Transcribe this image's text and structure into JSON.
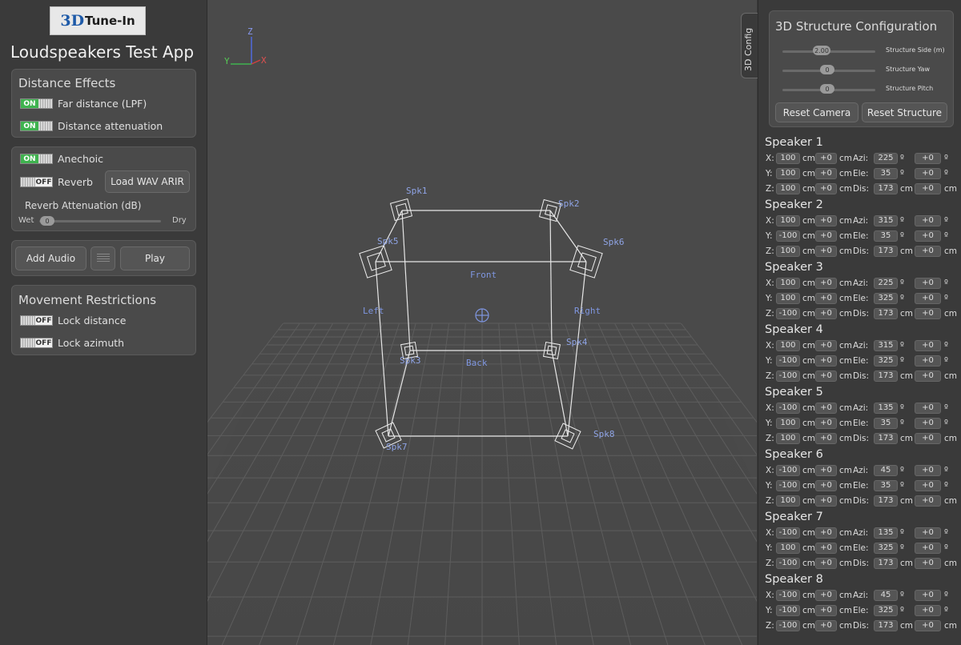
{
  "logo": {
    "mark": "3D",
    "text": "Tune-In"
  },
  "app_title": "Loudspeakers Test App",
  "distance_effects": {
    "title": "Distance Effects",
    "far_distance": {
      "state": "ON",
      "label": "Far distance (LPF)"
    },
    "attenuation": {
      "state": "ON",
      "label": "Distance attenuation"
    }
  },
  "environment": {
    "anechoic": {
      "state": "ON",
      "label": "Anechoic"
    },
    "reverb": {
      "state": "OFF",
      "label": "Reverb"
    },
    "load_button": "Load WAV ARIR",
    "reverb_attenuation_label": "Reverb Attenuation (dB)",
    "wet_label": "Wet",
    "dry_label": "Dry",
    "slider_value": "0"
  },
  "audio": {
    "add_label": "Add Audio",
    "play_label": "Play"
  },
  "movement": {
    "title": "Movement Restrictions",
    "lock_distance": {
      "state": "OFF",
      "label": "Lock distance"
    },
    "lock_azimuth": {
      "state": "OFF",
      "label": "Lock azimuth"
    }
  },
  "tab_3d_config": "3D Config",
  "axes": {
    "z": "Z",
    "y": "Y",
    "x": "X"
  },
  "scene_labels": {
    "front": "Front",
    "back": "Back",
    "left": "Left",
    "right": "Right"
  },
  "speaker_labels": [
    "Spk1",
    "Spk2",
    "Spk3",
    "Spk4",
    "Spk5",
    "Spk6",
    "Spk7",
    "Spk8"
  ],
  "structure_config": {
    "title": "3D Structure Configuration",
    "side_value": "2.00",
    "side_label": "Structure Side (m)",
    "yaw_value": "0",
    "yaw_label": "Structure Yaw",
    "pitch_value": "0",
    "pitch_label": "Structure Pitch",
    "reset_camera": "Reset Camera",
    "reset_structure": "Reset Structure"
  },
  "speakers": [
    {
      "name": "Speaker 1",
      "x": "100",
      "y": "100",
      "z": "100",
      "azi": "225",
      "ele": "35",
      "dis": "173"
    },
    {
      "name": "Speaker 2",
      "x": "100",
      "y": "-100",
      "z": "100",
      "azi": "315",
      "ele": "35",
      "dis": "173"
    },
    {
      "name": "Speaker 3",
      "x": "100",
      "y": "100",
      "z": "-100",
      "azi": "225",
      "ele": "325",
      "dis": "173"
    },
    {
      "name": "Speaker 4",
      "x": "100",
      "y": "-100",
      "z": "-100",
      "azi": "315",
      "ele": "325",
      "dis": "173"
    },
    {
      "name": "Speaker 5",
      "x": "-100",
      "y": "100",
      "z": "100",
      "azi": "135",
      "ele": "35",
      "dis": "173"
    },
    {
      "name": "Speaker 6",
      "x": "-100",
      "y": "-100",
      "z": "100",
      "azi": "45",
      "ele": "35",
      "dis": "173"
    },
    {
      "name": "Speaker 7",
      "x": "-100",
      "y": "100",
      "z": "-100",
      "azi": "135",
      "ele": "325",
      "dis": "173"
    },
    {
      "name": "Speaker 8",
      "x": "-100",
      "y": "-100",
      "z": "-100",
      "azi": "45",
      "ele": "325",
      "dis": "173"
    }
  ],
  "units": {
    "cm": "cm",
    "deg": "º",
    "offset": "+0"
  },
  "coord_labels": {
    "x": "X:",
    "y": "Y:",
    "z": "Z:",
    "azi": "Azi:",
    "ele": "Ele:",
    "dis": "Dis:"
  }
}
